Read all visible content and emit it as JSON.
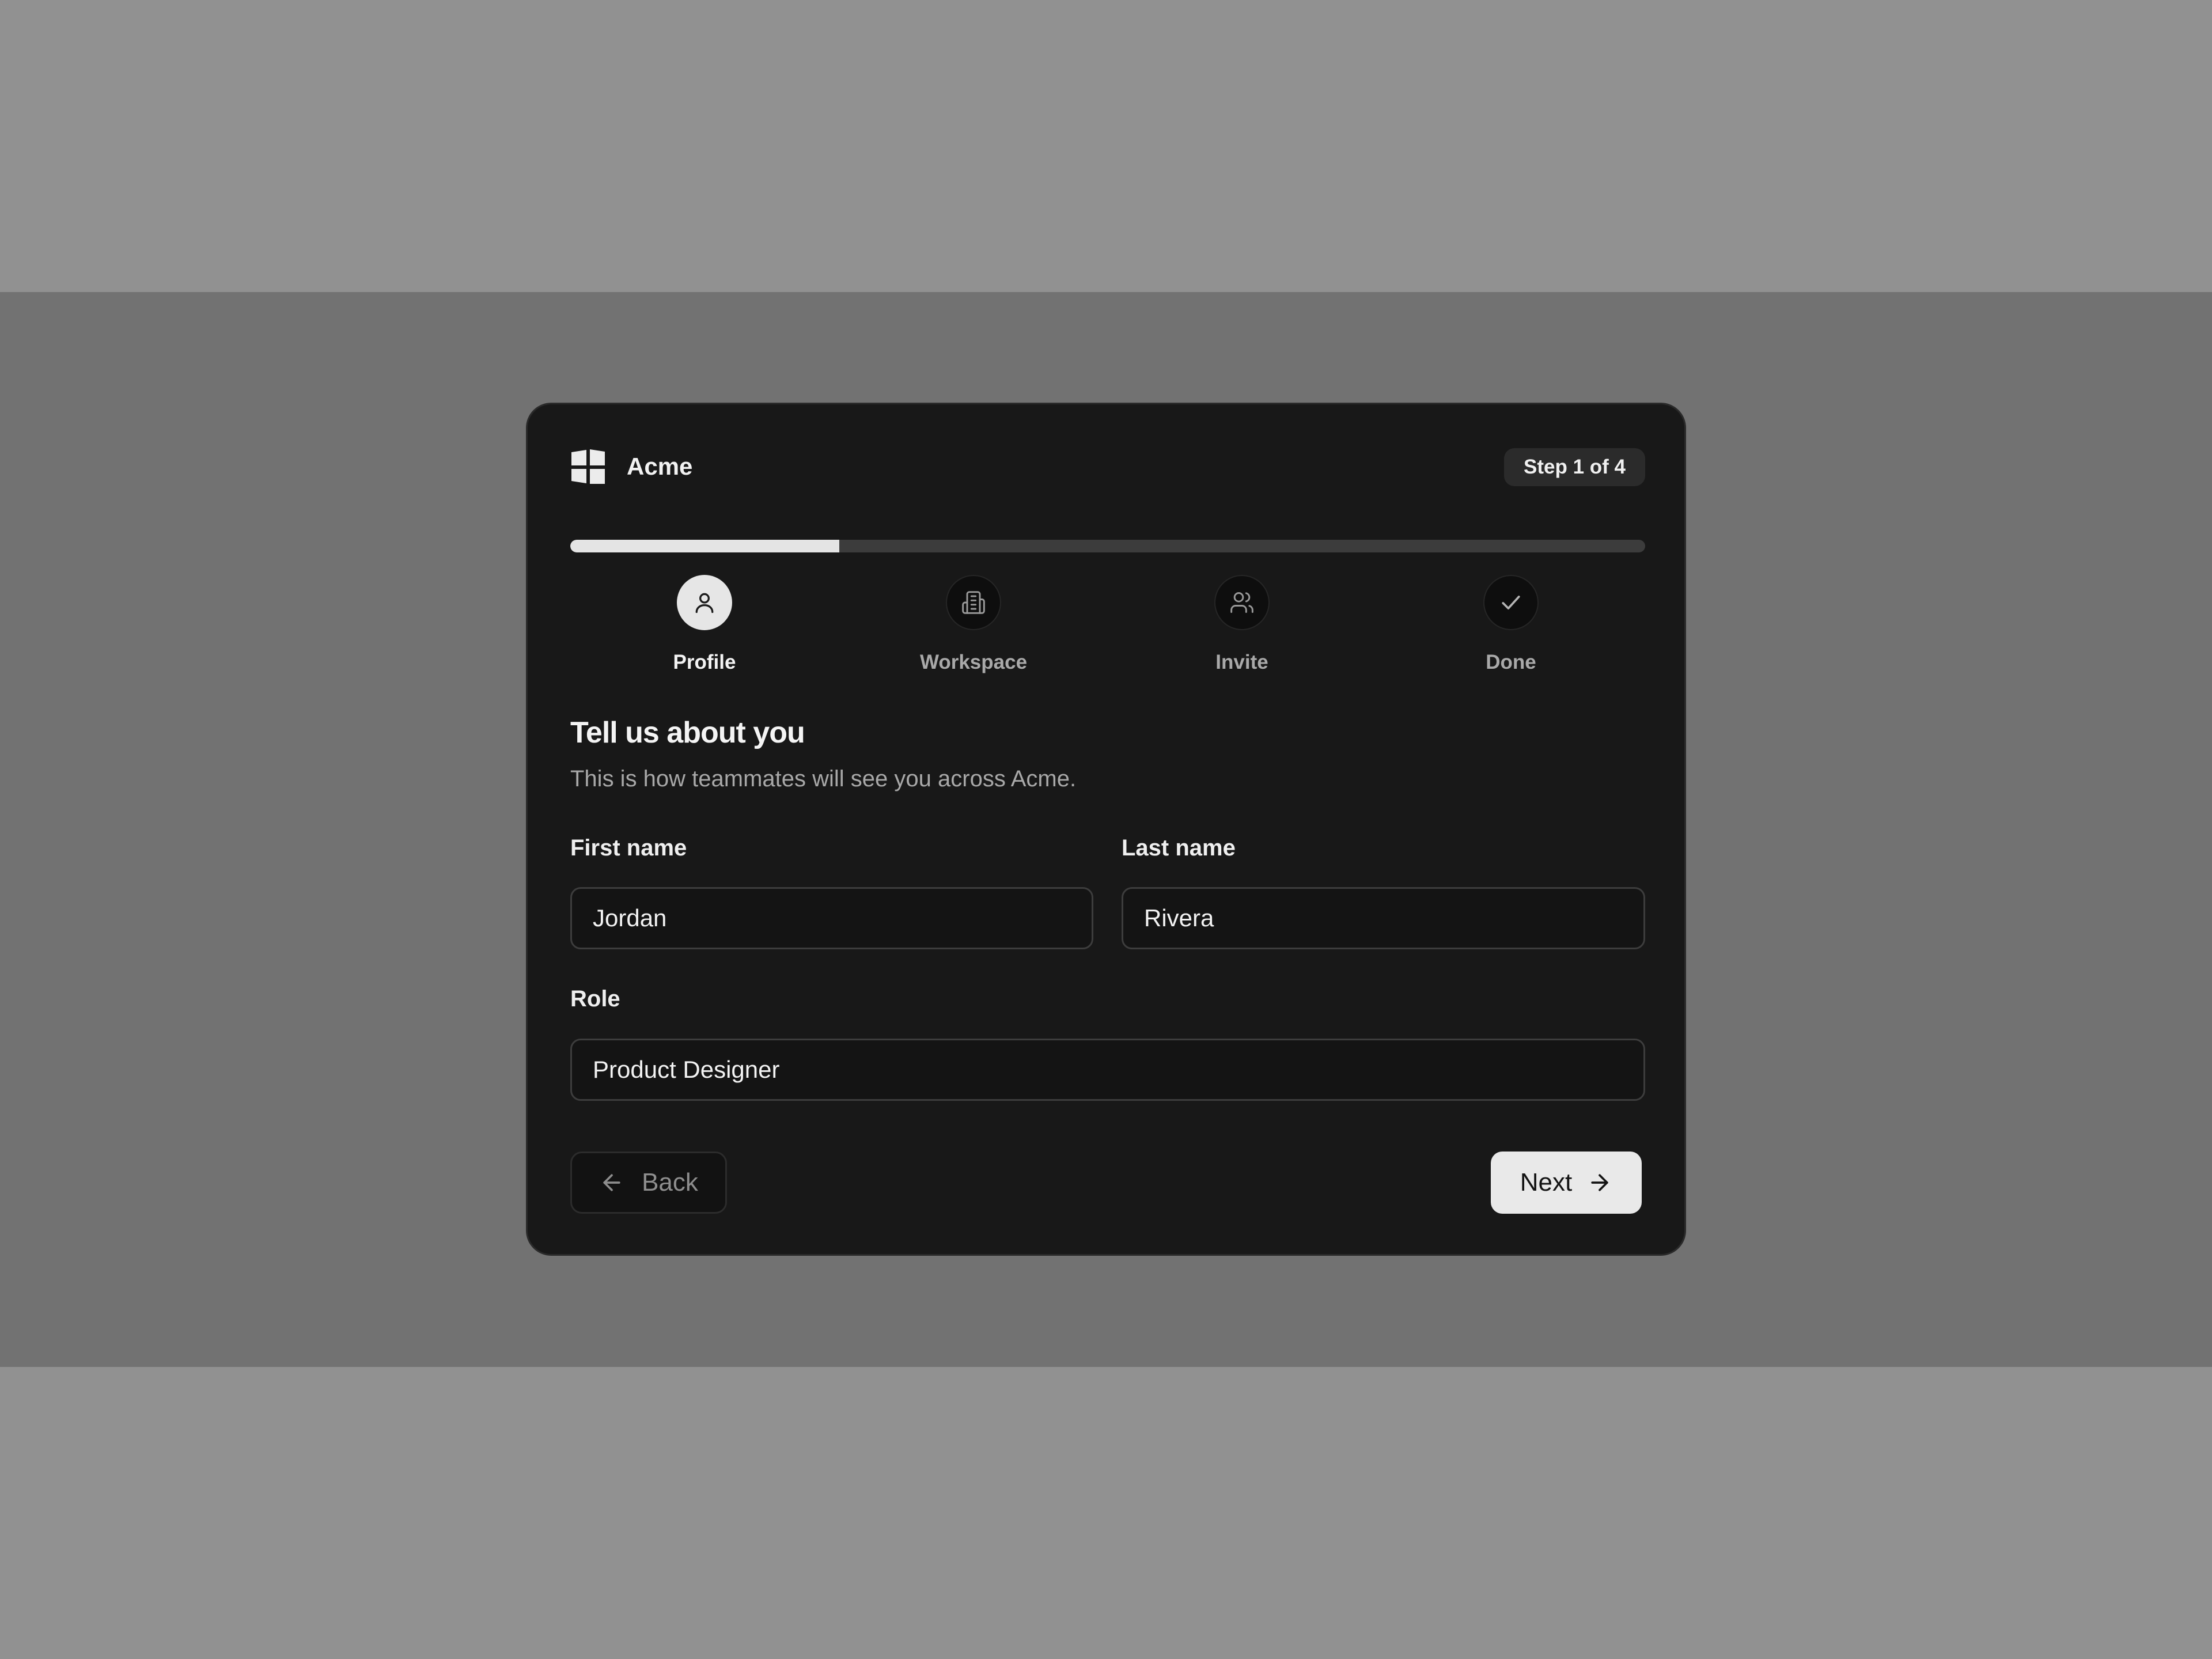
{
  "brand": {
    "name": "Acme",
    "logo_icon": "windows-grid-logo"
  },
  "step_badge": "Step 1 of 4",
  "progress": {
    "fraction": 0.25
  },
  "steps": [
    {
      "label": "Profile",
      "icon": "user-icon",
      "active": true
    },
    {
      "label": "Workspace",
      "icon": "building-icon",
      "active": false
    },
    {
      "label": "Invite",
      "icon": "users-icon",
      "active": false
    },
    {
      "label": "Done",
      "icon": "check-icon",
      "active": false
    }
  ],
  "form": {
    "title": "Tell us about you",
    "subtitle": "This is how teammates will see you across Acme.",
    "first_name": {
      "label": "First name",
      "value": "Jordan"
    },
    "last_name": {
      "label": "Last name",
      "value": "Rivera"
    },
    "role": {
      "label": "Role",
      "value": "Product Designer"
    }
  },
  "actions": {
    "back_label": "Back",
    "next_label": "Next"
  },
  "colors": {
    "card": "#181818",
    "accent": "#e9e9e9",
    "backdrop": "#727272",
    "page": "#919191"
  }
}
